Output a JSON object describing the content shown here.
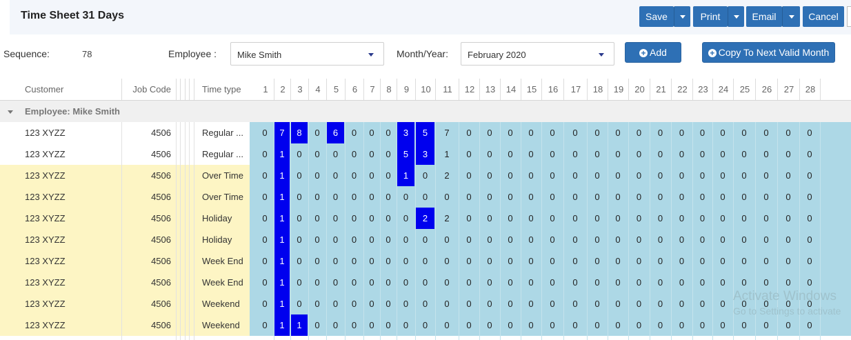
{
  "header": {
    "title": "Time Sheet 31 Days",
    "buttons": {
      "save": "Save",
      "print": "Print",
      "email": "Email",
      "cancel": "Cancel"
    }
  },
  "form": {
    "sequence_label": "Sequence:",
    "sequence_value": "78",
    "employee_label": "Employee :",
    "employee_value": "Mike Smith",
    "month_label": "Month/Year:",
    "month_value": "February 2020",
    "add_label": "Add",
    "copy_label": "Copy To Next Valid Month"
  },
  "columns": {
    "customer": "Customer",
    "job_code": "Job Code",
    "time_type": "Time type"
  },
  "days": [
    "1",
    "2",
    "3",
    "4",
    "5",
    "6",
    "7",
    "8",
    "9",
    "10",
    "11",
    "12",
    "13",
    "14",
    "15",
    "16",
    "17",
    "18",
    "19",
    "20",
    "21",
    "22",
    "23",
    "24",
    "25",
    "26",
    "27",
    "28"
  ],
  "group_label": "Employee: Mike Smith",
  "rows": [
    {
      "customer": "123 XYZZ",
      "job": "4506",
      "type": "Regular ...",
      "shaded": false,
      "values": [
        "0",
        "7",
        "8",
        "0",
        "6",
        "0",
        "0",
        "0",
        "3",
        "5",
        "7",
        "0",
        "0",
        "0",
        "0",
        "0",
        "0",
        "0",
        "0",
        "0",
        "0",
        "0",
        "0",
        "0",
        "0",
        "0",
        "0",
        "0"
      ],
      "highlight": [
        2,
        3,
        5,
        9,
        10
      ]
    },
    {
      "customer": "123 XYZZ",
      "job": "4506",
      "type": "Regular ...",
      "shaded": false,
      "values": [
        "0",
        "1",
        "0",
        "0",
        "0",
        "0",
        "0",
        "0",
        "5",
        "3",
        "1",
        "0",
        "0",
        "0",
        "0",
        "0",
        "0",
        "0",
        "0",
        "0",
        "0",
        "0",
        "0",
        "0",
        "0",
        "0",
        "0",
        "0"
      ],
      "highlight": [
        2,
        9,
        10
      ]
    },
    {
      "customer": "123 XYZZ",
      "job": "4506",
      "type": "Over Time",
      "shaded": true,
      "values": [
        "0",
        "1",
        "0",
        "0",
        "0",
        "0",
        "0",
        "0",
        "1",
        "0",
        "2",
        "0",
        "0",
        "0",
        "0",
        "0",
        "0",
        "0",
        "0",
        "0",
        "0",
        "0",
        "0",
        "0",
        "0",
        "0",
        "0",
        "0"
      ],
      "highlight": [
        2,
        9
      ]
    },
    {
      "customer": "123 XYZZ",
      "job": "4506",
      "type": "Over Time",
      "shaded": true,
      "values": [
        "0",
        "1",
        "0",
        "0",
        "0",
        "0",
        "0",
        "0",
        "0",
        "0",
        "0",
        "0",
        "0",
        "0",
        "0",
        "0",
        "0",
        "0",
        "0",
        "0",
        "0",
        "0",
        "0",
        "0",
        "0",
        "0",
        "0",
        "0"
      ],
      "highlight": [
        2
      ]
    },
    {
      "customer": "123 XYZZ",
      "job": "4506",
      "type": "Holiday",
      "shaded": true,
      "values": [
        "0",
        "1",
        "0",
        "0",
        "0",
        "0",
        "0",
        "0",
        "0",
        "2",
        "2",
        "0",
        "0",
        "0",
        "0",
        "0",
        "0",
        "0",
        "0",
        "0",
        "0",
        "0",
        "0",
        "0",
        "0",
        "0",
        "0",
        "0"
      ],
      "highlight": [
        2,
        10
      ]
    },
    {
      "customer": "123 XYZZ",
      "job": "4506",
      "type": "Holiday",
      "shaded": true,
      "values": [
        "0",
        "1",
        "0",
        "0",
        "0",
        "0",
        "0",
        "0",
        "0",
        "0",
        "0",
        "0",
        "0",
        "0",
        "0",
        "0",
        "0",
        "0",
        "0",
        "0",
        "0",
        "0",
        "0",
        "0",
        "0",
        "0",
        "0",
        "0"
      ],
      "highlight": [
        2
      ]
    },
    {
      "customer": "123 XYZZ",
      "job": "4506",
      "type": "Week End",
      "shaded": true,
      "values": [
        "0",
        "1",
        "0",
        "0",
        "0",
        "0",
        "0",
        "0",
        "0",
        "0",
        "0",
        "0",
        "0",
        "0",
        "0",
        "0",
        "0",
        "0",
        "0",
        "0",
        "0",
        "0",
        "0",
        "0",
        "0",
        "0",
        "0",
        "0"
      ],
      "highlight": [
        2
      ]
    },
    {
      "customer": "123 XYZZ",
      "job": "4506",
      "type": "Week End",
      "shaded": true,
      "values": [
        "0",
        "1",
        "0",
        "0",
        "0",
        "0",
        "0",
        "0",
        "0",
        "0",
        "0",
        "0",
        "0",
        "0",
        "0",
        "0",
        "0",
        "0",
        "0",
        "0",
        "0",
        "0",
        "0",
        "0",
        "0",
        "0",
        "0",
        "0"
      ],
      "highlight": [
        2
      ]
    },
    {
      "customer": "123 XYZZ",
      "job": "4506",
      "type": "Weekend",
      "shaded": true,
      "values": [
        "0",
        "1",
        "0",
        "0",
        "0",
        "0",
        "0",
        "0",
        "0",
        "0",
        "0",
        "0",
        "0",
        "0",
        "0",
        "0",
        "0",
        "0",
        "0",
        "0",
        "0",
        "0",
        "0",
        "0",
        "0",
        "0",
        "0",
        "0"
      ],
      "highlight": [
        2
      ]
    },
    {
      "customer": "123 XYZZ",
      "job": "4506",
      "type": "Weekend",
      "shaded": true,
      "values": [
        "0",
        "1",
        "1",
        "0",
        "0",
        "0",
        "0",
        "0",
        "0",
        "0",
        "0",
        "0",
        "0",
        "0",
        "0",
        "0",
        "0",
        "0",
        "0",
        "0",
        "0",
        "0",
        "0",
        "0",
        "0",
        "0",
        "0",
        "0"
      ],
      "highlight": [
        2,
        3
      ]
    }
  ],
  "watermark": {
    "line1": "Activate Windows",
    "line2": "Go to Settings to activate"
  },
  "colors": {
    "accent": "#2e70b5",
    "highlight": "#0000ee",
    "day_bg": "#add8e6",
    "shaded_row": "#fdf5c4"
  }
}
